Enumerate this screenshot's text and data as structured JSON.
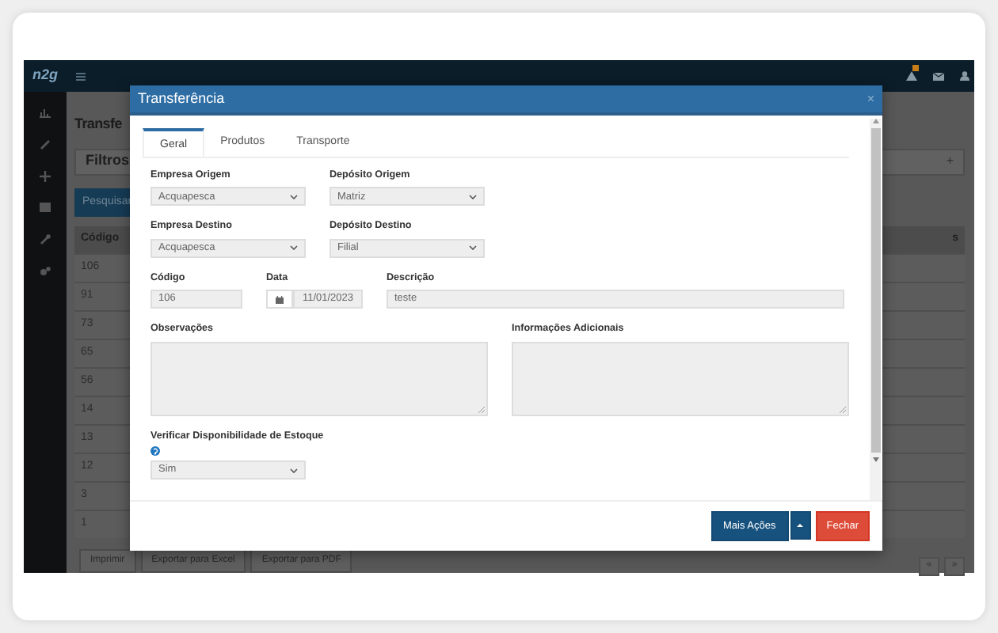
{
  "app": {
    "logo": "n2g"
  },
  "page": {
    "title": "Transfe",
    "filters": {
      "title": "Filtros",
      "toggle": "+"
    },
    "search_button": "Pesquisar",
    "table": {
      "columns": [
        "Código",
        "s"
      ],
      "rows": [
        "106",
        "91",
        "73",
        "65",
        "56",
        "14",
        "13",
        "12",
        "3",
        "1"
      ]
    },
    "footer_buttons": [
      "Imprimir",
      "Exportar para Excel",
      "Exportar para PDF"
    ],
    "pagination": [
      "«",
      "»"
    ]
  },
  "modal": {
    "title": "Transferência",
    "close": "×",
    "tabs": [
      {
        "label": "Geral",
        "selected": true
      },
      {
        "label": "Produtos",
        "selected": false
      },
      {
        "label": "Transporte",
        "selected": false
      }
    ],
    "rows": [
      [
        {
          "label": "Empresa Origem",
          "kind": "select",
          "value": "Acquapesca"
        },
        {
          "label": "Depósito Origem",
          "kind": "select",
          "value": "Matriz"
        }
      ],
      [
        {
          "label": "Empresa Destino",
          "kind": "select",
          "value": "Acquapesca"
        },
        {
          "label": "Depósito Destino",
          "kind": "select",
          "value": "Filial"
        }
      ],
      [
        {
          "label": "Código",
          "kind": "input",
          "value": "106"
        },
        {
          "label": "Data",
          "kind": "date",
          "value": "11/01/2023"
        },
        {
          "label": "Descrição",
          "kind": "input",
          "value": "teste"
        }
      ],
      [
        {
          "label": "Observações",
          "kind": "textarea"
        },
        {
          "label": "Informações Adicionais",
          "kind": "textarea"
        }
      ],
      [
        {
          "label": "Verificar Disponibilidade de Estoque",
          "kind": "select",
          "value": "Sim",
          "help": true
        }
      ]
    ],
    "buttons": [
      {
        "label": "Mais Ações",
        "kind": "split"
      },
      {
        "label": "Fechar",
        "kind": "danger"
      }
    ]
  }
}
